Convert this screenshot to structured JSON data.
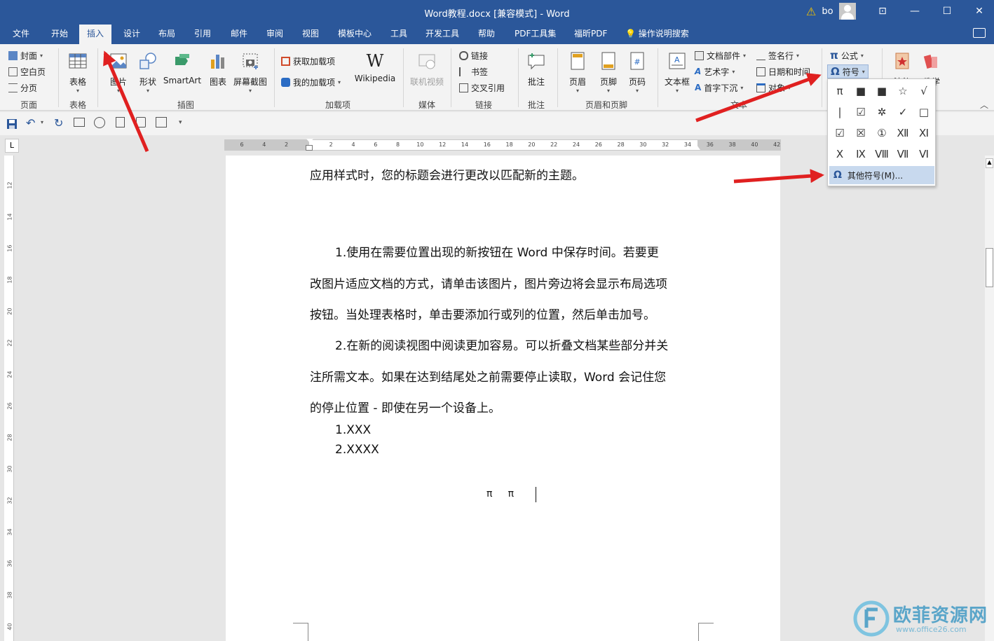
{
  "window": {
    "title": "Word教程.docx [兼容模式]  -  Word",
    "user": "bo",
    "buttons": {
      "ribbon_display": "⊡",
      "minimize": "—",
      "maximize": "☐",
      "close": "✕"
    }
  },
  "tabs": [
    "文件",
    "开始",
    "插入",
    "设计",
    "布局",
    "引用",
    "邮件",
    "审阅",
    "视图",
    "模板中心",
    "工具",
    "开发工具",
    "帮助",
    "PDF工具集",
    "福昕PDF"
  ],
  "active_tab": "插入",
  "tell_me": "操作说明搜索",
  "ribbon": {
    "pages": {
      "cover": "封面",
      "blank": "空白页",
      "break": "分页",
      "label": "页面"
    },
    "tables": {
      "table": "表格",
      "label": "表格"
    },
    "illustrations": {
      "picture": "图片",
      "shapes": "形状",
      "smartart": "SmartArt",
      "chart": "图表",
      "screenshot": "屏幕截图",
      "label": "插图"
    },
    "addins": {
      "get": "获取加载项",
      "my": "我的加载项",
      "wikipedia": "Wikipedia",
      "label": "加载项"
    },
    "media": {
      "online_video": "联机视频",
      "label": "媒体"
    },
    "links": {
      "link": "链接",
      "bookmark": "书签",
      "cross_ref": "交叉引用",
      "label": "链接"
    },
    "comments": {
      "comment": "批注",
      "label": "批注"
    },
    "header_footer": {
      "header": "页眉",
      "footer": "页脚",
      "page_number": "页码",
      "label": "页眉和页脚"
    },
    "text": {
      "textbox": "文本框",
      "parts": "文档部件",
      "wordart": "艺术字",
      "dropcap": "首字下沉",
      "signature": "签名行",
      "datetime": "日期和时间",
      "object": "对象",
      "label": "文本"
    },
    "symbols": {
      "equation": "公式",
      "symbol": "符号"
    },
    "extra": {
      "law": "法律",
      "edu": "教学"
    }
  },
  "symbol_dropdown": {
    "symbols": [
      "π",
      "■",
      "■",
      "☆",
      "√",
      "|",
      "☑",
      "✲",
      "✓",
      "□",
      "☑",
      "☒",
      "①",
      "Ⅻ",
      "Ⅺ",
      "Ⅹ",
      "Ⅸ",
      "Ⅷ",
      "Ⅶ",
      "Ⅵ"
    ],
    "more_label": "其他符号(M)..."
  },
  "ruler": {
    "top": [
      "6",
      "4",
      "2",
      "",
      "2",
      "4",
      "6",
      "8",
      "10",
      "12",
      "14",
      "16",
      "18",
      "20",
      "22",
      "24",
      "26",
      "28",
      "30",
      "32",
      "34",
      "36",
      "38",
      "40",
      "42"
    ],
    "left": [
      "12",
      "14",
      "16",
      "18",
      "20",
      "22",
      "24",
      "26",
      "28",
      "30",
      "32",
      "34",
      "36",
      "38",
      "40"
    ]
  },
  "document": {
    "lines": [
      "应用样式时，您的标题会进行更改以匹配新的主题。",
      "1.使用在需要位置出现的新按钮在 Word 中保存时间。若要更",
      "改图片适应文档的方式，请单击该图片，图片旁边将会显示布局选项",
      "按钮。当处理表格时，单击要添加行或列的位置，然后单击加号。",
      "2.在新的阅读视图中阅读更加容易。可以折叠文档某些部分并关",
      "注所需文本。如果在达到结尾处之前需要停止读取，Word 会记住您",
      "的停止位置 - 即使在另一个设备上。",
      "1.XXX",
      "2.XXXX"
    ],
    "symbols_line": "π     π"
  },
  "watermark": {
    "text": "欧菲资源网",
    "sub": "www.office26.com"
  },
  "colors": {
    "accent": "#2b579a",
    "arrow": "#e02020",
    "watermark": "#5aa5c9"
  }
}
